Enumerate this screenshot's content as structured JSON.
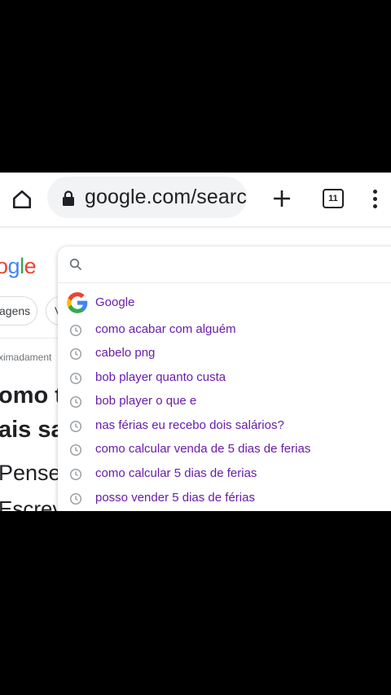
{
  "browser": {
    "url": "google.com/searc",
    "tab_count": "11"
  },
  "page": {
    "logo_letters": [
      "o",
      "g",
      "l",
      "e"
    ],
    "logo_colors": [
      "#ea4335",
      "#4285f4",
      "#34a853",
      "#ea4335"
    ],
    "chips": [
      "agens",
      "V"
    ],
    "approx_text": "ximadament",
    "heading_line1": "omo t",
    "heading_line2": "ais sa",
    "body_line1": "Pense",
    "body_line2": "Escrev"
  },
  "dropdown": {
    "search_placeholder": "",
    "top_suggestion": "Google",
    "history": [
      "como acabar com alguém",
      "cabelo png",
      "bob player quanto custa",
      "bob player o que e",
      "nas férias eu recebo dois salários?",
      "como calcular venda de 5 dias de ferias",
      "como calcular 5 dias de ferias",
      "posso vender 5 dias de férias"
    ]
  },
  "colors": {
    "visited_link": "#681da8",
    "google_blue": "#4285f4",
    "google_red": "#ea4335",
    "google_yellow": "#fbbc05",
    "google_green": "#34a853"
  }
}
